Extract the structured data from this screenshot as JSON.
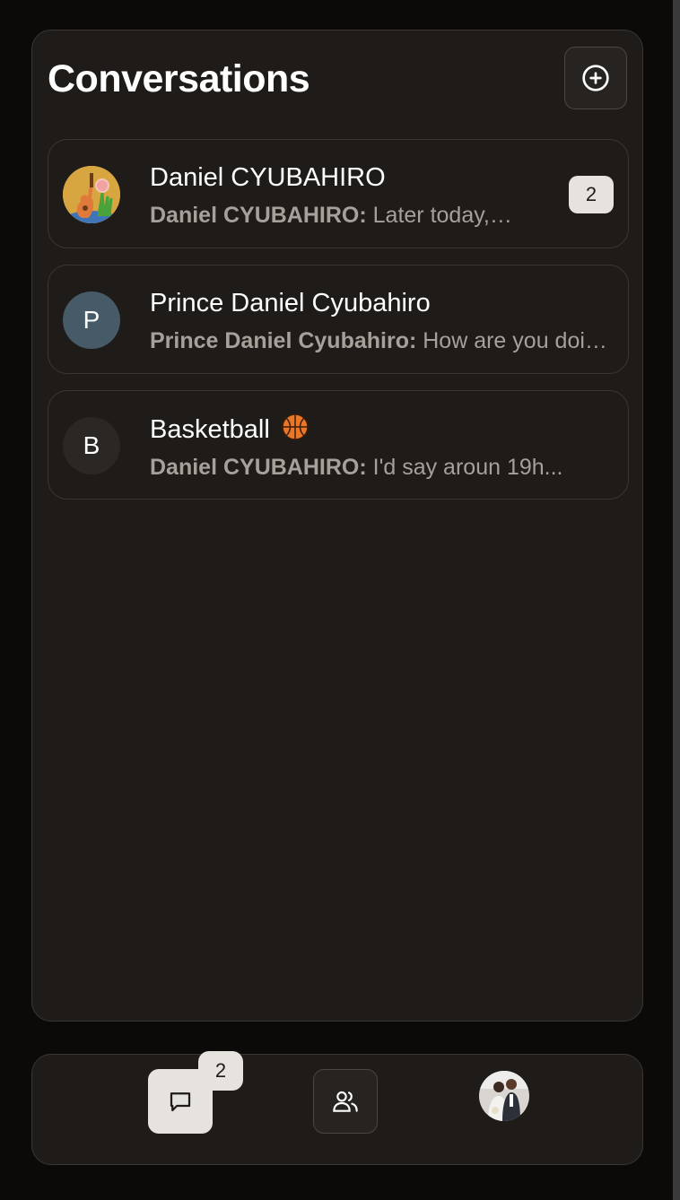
{
  "header": {
    "title": "Conversations",
    "new_button_icon": "plus-circle-icon"
  },
  "conversations": [
    {
      "name": "Daniel CYUBAHIRO",
      "avatar_type": "image",
      "avatar_icon": "guitar-cactus-avatar",
      "sender": "Daniel CYUBAHIRO:",
      "preview": "Later today, what time works?",
      "unread": "2"
    },
    {
      "name": "Prince Daniel Cyubahiro",
      "avatar_type": "initial",
      "avatar_letter": "P",
      "avatar_color": "#465a67",
      "sender": "Prince Daniel Cyubahiro:",
      "preview": "How are you doing?"
    },
    {
      "name": "Basketball",
      "name_emoji": "basketball-icon",
      "avatar_type": "initial",
      "avatar_letter": "B",
      "avatar_color": "#2a2725",
      "sender": "Daniel CYUBAHIRO:",
      "preview": "I'd say aroun 19h..."
    }
  ],
  "bottom_nav": {
    "chat_icon": "message-square-icon",
    "chat_badge": "2",
    "people_icon": "users-icon",
    "profile_icon": "profile-photo-avatar"
  },
  "colors": {
    "background": "#0b0a09",
    "panel": "#1e1b18",
    "border": "#3a3633",
    "badge": "#e6e3df",
    "muted_text": "#a6a09a"
  }
}
